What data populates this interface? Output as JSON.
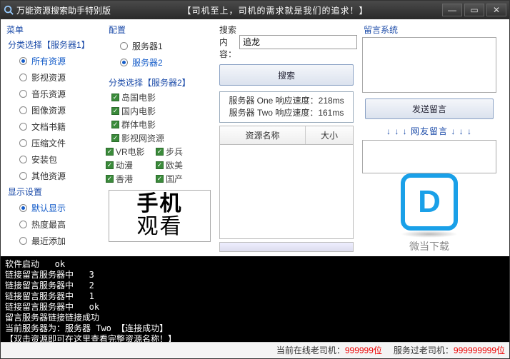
{
  "titlebar": {
    "title": "万能资源搜索助手特别版",
    "slogan": "【司机至上，司机的需求就是我们的追求！】"
  },
  "menu": {
    "title": "菜单"
  },
  "cat": {
    "label": "分类选择【服务器1】",
    "items": [
      "所有资源",
      "影视资源",
      "音乐资源",
      "图像资源",
      "文档书籍",
      "压缩文件",
      "安装包",
      "其他资源"
    ],
    "selected": 0
  },
  "disp": {
    "label": "显示设置",
    "items": [
      "默认显示",
      "热度最高",
      "最近添加"
    ],
    "selected": 0
  },
  "cfg": {
    "label": "配置",
    "servers": [
      "服务器1",
      "服务器2"
    ],
    "selected": 1
  },
  "cat2": {
    "label": "分类选择【服务器2】",
    "colA": [
      "岛国电影",
      "国内电影",
      "群体电影",
      "影视网资源"
    ],
    "gridL": [
      "VR电影",
      "动漫",
      "香港"
    ],
    "gridR": [
      "步兵",
      "欧美",
      "国产"
    ]
  },
  "promo": {
    "l1": "手机",
    "l2": "观看"
  },
  "search": {
    "label": "搜索内容：",
    "value": "追龙",
    "button": "搜索"
  },
  "speed": {
    "line1": "服务器 One 响应速度：218ms",
    "line2": "服务器 Two 响应速度：161ms"
  },
  "table": {
    "h1": "资源名称",
    "h2": "大小"
  },
  "msg": {
    "title": "留言系统",
    "send": "发送留言",
    "arrows": "↓ ↓ ↓ 网友留言 ↓ ↓ ↓"
  },
  "wm": {
    "text": "微当下载"
  },
  "console": "软件启动   ok\n链接留言服务器中   3\n链接留言服务器中   2\n链接留言服务器中   1\n链接留言服务器中   ok\n留言服务器链接链接成功\n当前服务器为：服务器 Two 【连接成功】\n【双击资源即可在这里查看完整资源名称！】",
  "status": {
    "online_lbl": "当前在线老司机：",
    "online_val": "999999位",
    "served_lbl": "服务过老司机：",
    "served_val": "999999999位"
  }
}
